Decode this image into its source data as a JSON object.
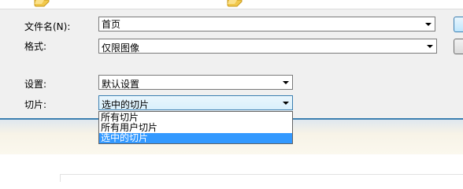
{
  "filename": {
    "label": "文件名(N):",
    "value": "首页"
  },
  "format": {
    "label": "格式:",
    "value": "仅限图像"
  },
  "settings": {
    "label": "设置:",
    "value": "默认设置"
  },
  "slices": {
    "label": "切片:",
    "value": "选中的切片",
    "options": [
      "所有切片",
      "所有用户切片",
      "选中的切片"
    ]
  },
  "icons": [
    "folder-icon",
    "folder-icon",
    "chevron-down-icon"
  ],
  "colors": {
    "accent": "#3399ff",
    "separator": "#3c7fb1",
    "dialog_bg": "#f0f0f0"
  }
}
